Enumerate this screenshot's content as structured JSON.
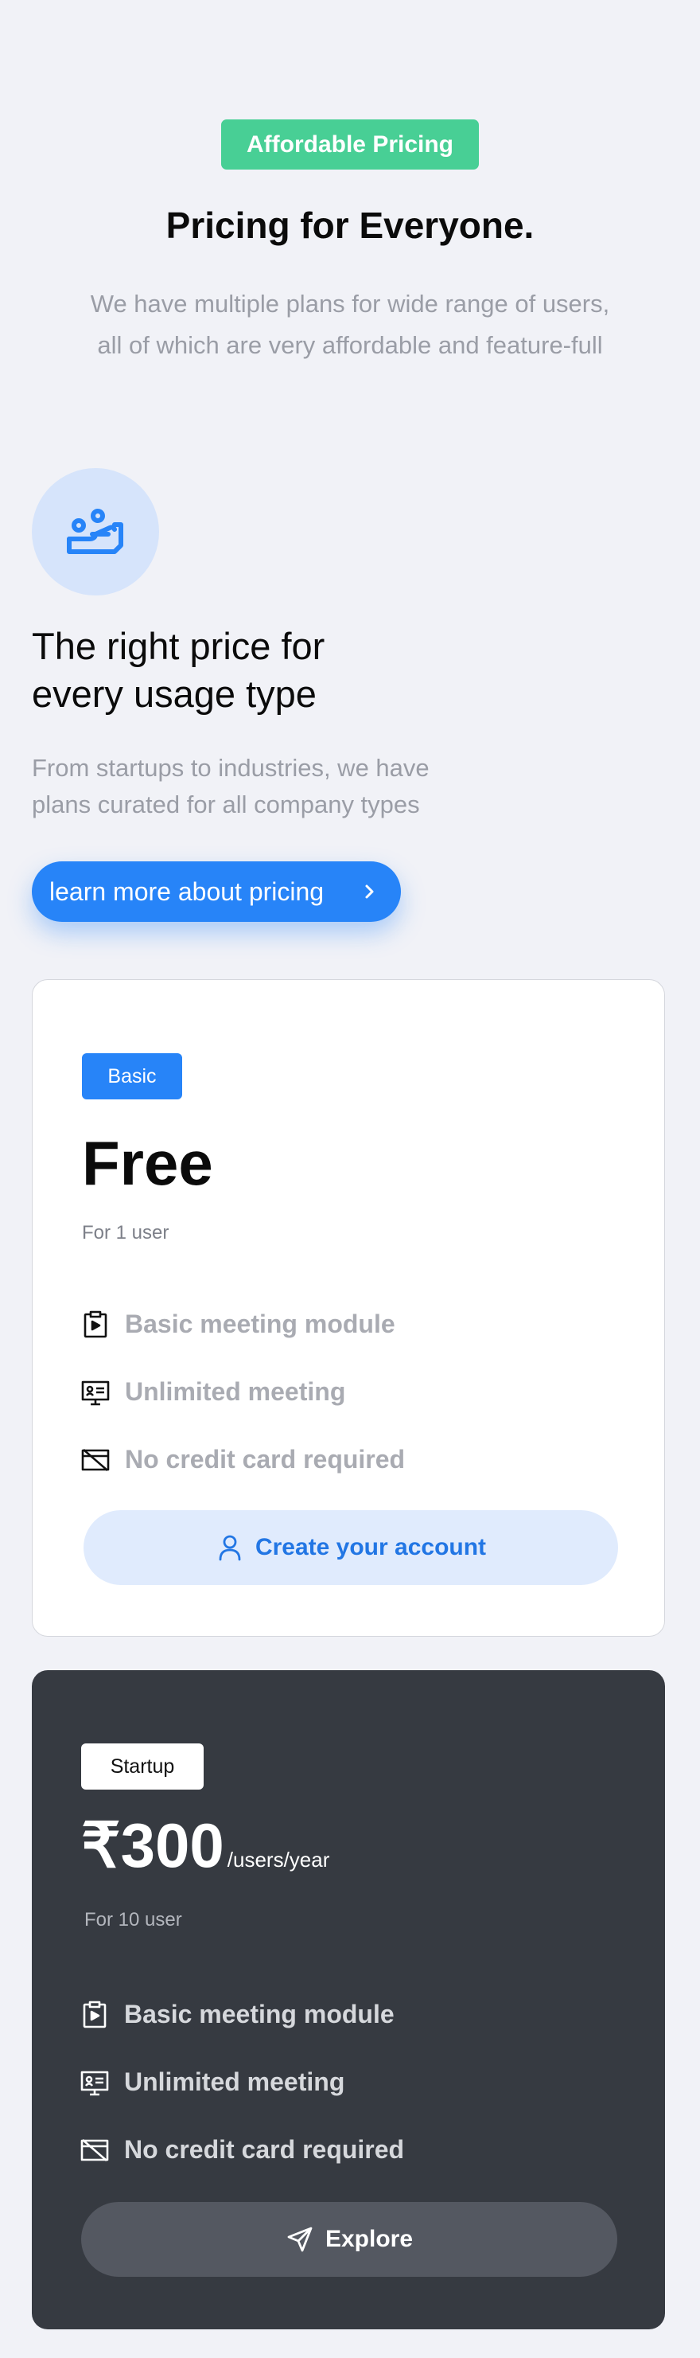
{
  "hero": {
    "badge": "Affordable Pricing",
    "title": "Pricing for Everyone.",
    "subtitle_line1": "We have multiple plans for wide range of users,",
    "subtitle_line2": "all of which are very affordable and feature-full"
  },
  "intro": {
    "icon": "hand-holding-people-icon",
    "title_line1": "The right price for",
    "title_line2": "every usage type",
    "subtitle_line1": "From startups to industries, we have",
    "subtitle_line2": "plans curated for all company types",
    "cta_label": "learn more about pricing"
  },
  "plans": [
    {
      "tag": "Basic",
      "price": "Free",
      "per": "",
      "for": "For 1 user",
      "features": [
        "Basic meeting module",
        "Unlimited meeting",
        "No credit card required"
      ],
      "button": "Create your account",
      "button_icon": "user-icon"
    },
    {
      "tag": "Startup",
      "price": "₹300",
      "per": "/users/year",
      "for": "For 10 user",
      "features": [
        "Basic meeting module",
        "Unlimited meeting",
        "No credit card required"
      ],
      "button": "Explore",
      "button_icon": "send-icon"
    }
  ],
  "colors": {
    "accent": "#2784f8",
    "badge_green": "#48cf95",
    "background": "#f1f2f7",
    "dark_card": "#363a41"
  }
}
